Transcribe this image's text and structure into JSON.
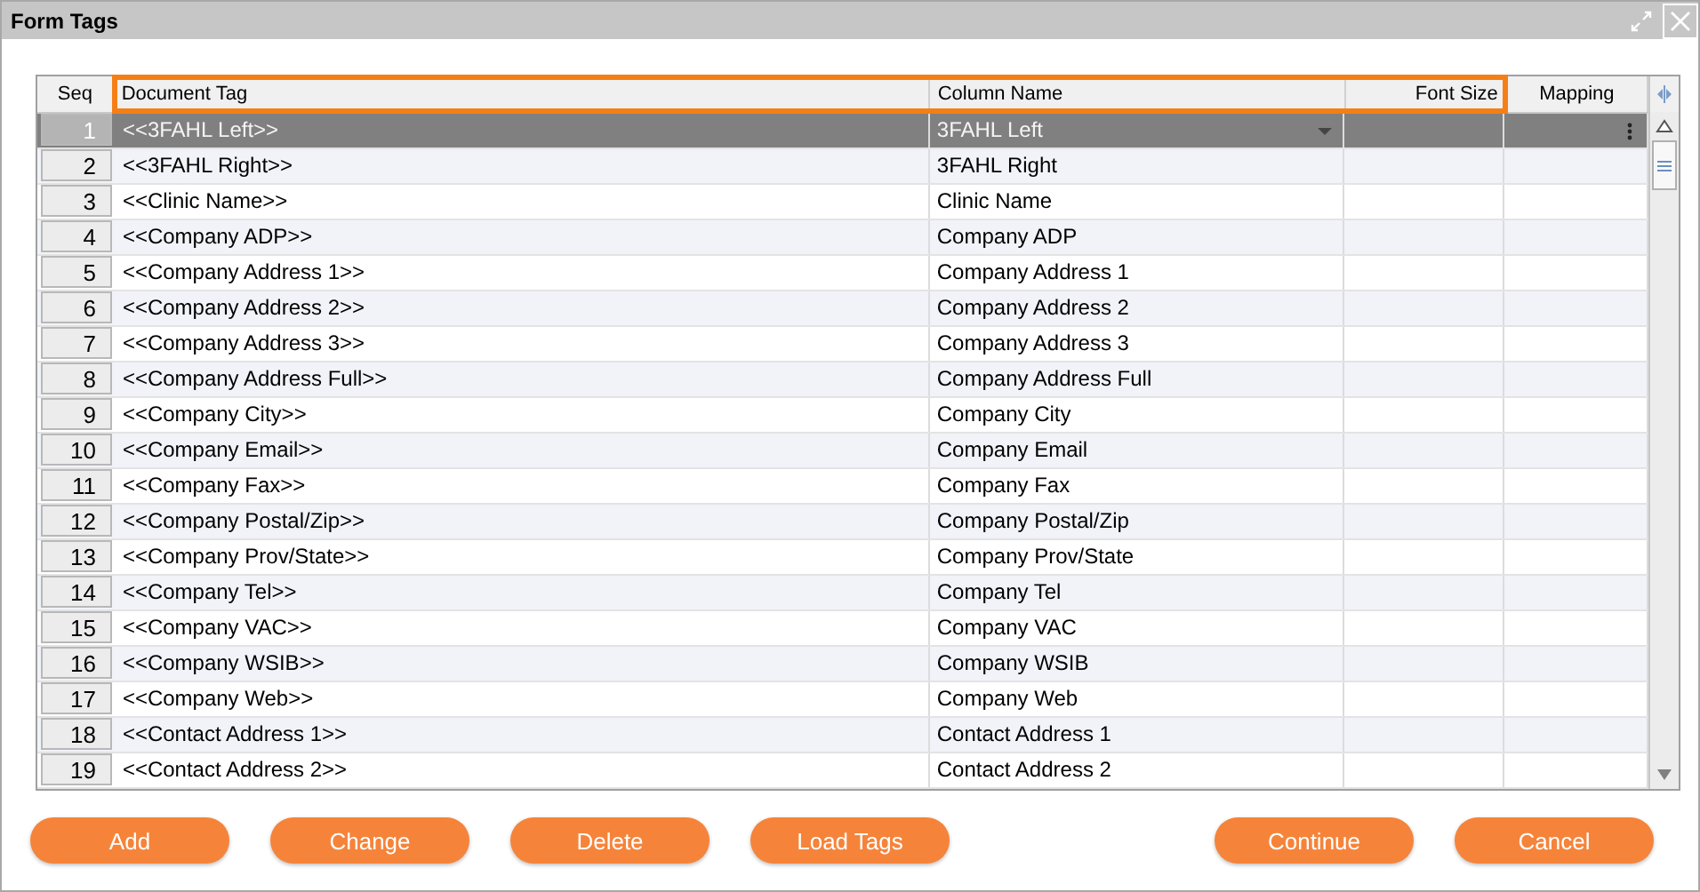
{
  "window": {
    "title": "Form Tags"
  },
  "table": {
    "columns": [
      {
        "label": "Seq",
        "highlighted": false
      },
      {
        "label": "Document Tag",
        "highlighted": true
      },
      {
        "label": "Column Name",
        "highlighted": true
      },
      {
        "label": "Font Size",
        "highlighted": true
      },
      {
        "label": "Mapping",
        "highlighted": false
      }
    ],
    "rows": [
      {
        "seq": "1",
        "tag": "<<3FAHL Left>>",
        "column_name": "3FAHL Left",
        "selected": true
      },
      {
        "seq": "2",
        "tag": "<<3FAHL Right>>",
        "column_name": "3FAHL Right",
        "selected": false
      },
      {
        "seq": "3",
        "tag": "<<Clinic Name>>",
        "column_name": "Clinic Name",
        "selected": false
      },
      {
        "seq": "4",
        "tag": "<<Company ADP>>",
        "column_name": "Company ADP",
        "selected": false
      },
      {
        "seq": "5",
        "tag": "<<Company Address 1>>",
        "column_name": "Company Address 1",
        "selected": false
      },
      {
        "seq": "6",
        "tag": "<<Company Address 2>>",
        "column_name": "Company Address 2",
        "selected": false
      },
      {
        "seq": "7",
        "tag": "<<Company Address 3>>",
        "column_name": "Company Address 3",
        "selected": false
      },
      {
        "seq": "8",
        "tag": "<<Company Address Full>>",
        "column_name": "Company Address Full",
        "selected": false
      },
      {
        "seq": "9",
        "tag": "<<Company City>>",
        "column_name": "Company City",
        "selected": false
      },
      {
        "seq": "10",
        "tag": "<<Company Email>>",
        "column_name": "Company Email",
        "selected": false
      },
      {
        "seq": "11",
        "tag": "<<Company Fax>>",
        "column_name": "Company Fax",
        "selected": false
      },
      {
        "seq": "12",
        "tag": "<<Company Postal/Zip>>",
        "column_name": "Company Postal/Zip",
        "selected": false
      },
      {
        "seq": "13",
        "tag": "<<Company Prov/State>>",
        "column_name": "Company Prov/State",
        "selected": false
      },
      {
        "seq": "14",
        "tag": "<<Company Tel>>",
        "column_name": "Company Tel",
        "selected": false
      },
      {
        "seq": "15",
        "tag": "<<Company VAC>>",
        "column_name": "Company VAC",
        "selected": false
      },
      {
        "seq": "16",
        "tag": "<<Company WSIB>>",
        "column_name": "Company WSIB",
        "selected": false
      },
      {
        "seq": "17",
        "tag": "<<Company Web>>",
        "column_name": "Company Web",
        "selected": false
      },
      {
        "seq": "18",
        "tag": "<<Contact Address 1>>",
        "column_name": "Contact Address 1",
        "selected": false
      },
      {
        "seq": "19",
        "tag": "<<Contact Address 2>>",
        "column_name": "Contact Address 2",
        "selected": false
      }
    ]
  },
  "buttons_left": [
    "Add",
    "Change",
    "Delete",
    "Load Tags"
  ],
  "buttons_right": [
    "Continue",
    "Cancel"
  ]
}
